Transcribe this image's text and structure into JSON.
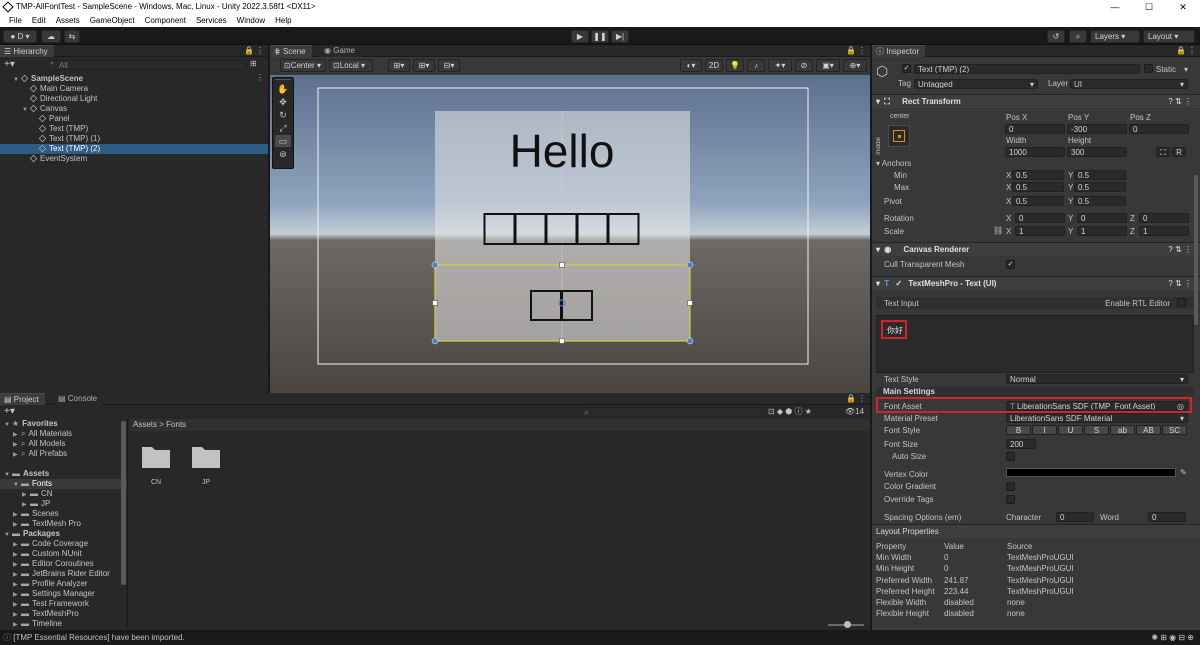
{
  "window": {
    "title": "TMP-AllFontTest - SampleScene - Windows, Mac, Linux - Unity 2022.3.58f1 <DX11>"
  },
  "menu": [
    "File",
    "Edit",
    "Assets",
    "GameObject",
    "Component",
    "Services",
    "Window",
    "Help"
  ],
  "toolbar": {
    "account": "D",
    "layers": "Layers",
    "layout": "Layout"
  },
  "hierarchy": {
    "tab": "Hierarchy",
    "search_placeholder": "All",
    "items": [
      {
        "label": "SampleScene",
        "depth": 0,
        "type": "scene"
      },
      {
        "label": "Main Camera",
        "depth": 1,
        "type": "obj"
      },
      {
        "label": "Directional Light",
        "depth": 1,
        "type": "obj"
      },
      {
        "label": "Canvas",
        "depth": 1,
        "type": "obj"
      },
      {
        "label": "Panel",
        "depth": 2,
        "type": "obj"
      },
      {
        "label": "Text (TMP)",
        "depth": 2,
        "type": "obj"
      },
      {
        "label": "Text (TMP) (1)",
        "depth": 2,
        "type": "obj"
      },
      {
        "label": "Text (TMP) (2)",
        "depth": 2,
        "type": "obj",
        "selected": true
      },
      {
        "label": "EventSystem",
        "depth": 1,
        "type": "obj"
      }
    ]
  },
  "scene": {
    "tabs": [
      "Scene",
      "Game"
    ],
    "pivot": "Center",
    "space": "Local",
    "mode2d": "2D",
    "hello_text": "Hello",
    "box_count_top": 5,
    "box_count_bottom": 2
  },
  "inspector": {
    "tab": "Inspector",
    "object_name": "Text (TMP) (2)",
    "static_label": "Static",
    "tag_label": "Tag",
    "tag_value": "Untagged",
    "layer_label": "Layer",
    "layer_value": "UI",
    "rect_transform": {
      "title": "Rect Transform",
      "anchor_preset": "center",
      "middle": "middle",
      "pos_x_label": "Pos X",
      "pos_y_label": "Pos Y",
      "pos_z_label": "Pos Z",
      "pos_x": "0",
      "pos_y": "-300",
      "pos_z": "0",
      "width_label": "Width",
      "height_label": "Height",
      "width": "1000",
      "height": "300",
      "r_btn": "R",
      "anchors_label": "Anchors",
      "min_label": "Min",
      "max_label": "Max",
      "pivot_label": "Pivot",
      "x_label": "X",
      "y_label": "Y",
      "z_label": "Z",
      "min_x": "0.5",
      "min_y": "0.5",
      "max_x": "0.5",
      "max_y": "0.5",
      "pivot_x": "0.5",
      "pivot_y": "0.5",
      "rotation_label": "Rotation",
      "rot_x": "0",
      "rot_y": "0",
      "rot_z": "0",
      "scale_label": "Scale",
      "scale_x": "1",
      "scale_y": "1",
      "scale_z": "1"
    },
    "canvas_renderer": {
      "title": "Canvas Renderer",
      "cull_label": "Cull Transparent Mesh"
    },
    "tmp": {
      "title": "TextMeshPro - Text (UI)",
      "text_input_label": "Text Input",
      "rtl_label": "Enable RTL Editor",
      "text_value": "你好",
      "text_style_label": "Text Style",
      "text_style": "Normal",
      "main_settings": "Main Settings",
      "font_asset_label": "Font Asset",
      "font_asset": "LiberationSans SDF (TMP_Font Asset)",
      "material_preset_label": "Material Preset",
      "material_preset": "LiberationSans SDF Material",
      "font_style_label": "Font Style",
      "font_styles": [
        "B",
        "I",
        "U",
        "S",
        "ab",
        "AB",
        "SC"
      ],
      "font_size_label": "Font Size",
      "font_size": "200",
      "auto_size_label": "Auto Size",
      "vertex_color_label": "Vertex Color",
      "color_gradient_label": "Color Gradient",
      "override_tags_label": "Override Tags",
      "spacing_label": "Spacing Options (em)",
      "character_label": "Character",
      "character_value": "0",
      "word_label": "Word",
      "word_value": "0"
    },
    "layout": {
      "title": "Layout Properties",
      "headers": [
        "Property",
        "Value",
        "Source"
      ],
      "rows": [
        [
          "Min Width",
          "0",
          "TextMeshProUGUI"
        ],
        [
          "Min Height",
          "0",
          "TextMeshProUGUI"
        ],
        [
          "Preferred Width",
          "241.87",
          "TextMeshProUGUI"
        ],
        [
          "Preferred Height",
          "223.44",
          "TextMeshProUGUI"
        ],
        [
          "Flexible Width",
          "disabled",
          "none"
        ],
        [
          "Flexible Height",
          "disabled",
          "none"
        ]
      ]
    }
  },
  "project": {
    "tabs": [
      "Project",
      "Console"
    ],
    "breadcrumb_root": "Assets",
    "breadcrumb_sep": ">",
    "breadcrumb_leaf": "Fonts",
    "count": "14",
    "tree": [
      {
        "label": "Favorites",
        "depth": 0,
        "bold": true
      },
      {
        "label": "All Materials",
        "depth": 1
      },
      {
        "label": "All Models",
        "depth": 1
      },
      {
        "label": "All Prefabs",
        "depth": 1
      },
      {
        "label": "",
        "depth": 0
      },
      {
        "label": "Assets",
        "depth": 0,
        "bold": true
      },
      {
        "label": "Fonts",
        "depth": 1,
        "selected": true
      },
      {
        "label": "CN",
        "depth": 2
      },
      {
        "label": "JP",
        "depth": 2
      },
      {
        "label": "Scenes",
        "depth": 1
      },
      {
        "label": "TextMesh Pro",
        "depth": 1
      },
      {
        "label": "Packages",
        "depth": 0,
        "bold": true
      },
      {
        "label": "Code Coverage",
        "depth": 1
      },
      {
        "label": "Custom NUnit",
        "depth": 1
      },
      {
        "label": "Editor Coroutines",
        "depth": 1
      },
      {
        "label": "JetBrains Rider Editor",
        "depth": 1
      },
      {
        "label": "Profile Analyzer",
        "depth": 1
      },
      {
        "label": "Settings Manager",
        "depth": 1
      },
      {
        "label": "Test Framework",
        "depth": 1
      },
      {
        "label": "TextMeshPro",
        "depth": 1
      },
      {
        "label": "Timeline",
        "depth": 1
      }
    ],
    "folders": [
      "CN",
      "JP"
    ]
  },
  "status": {
    "message": "[TMP Essential Resources] have been imported."
  }
}
